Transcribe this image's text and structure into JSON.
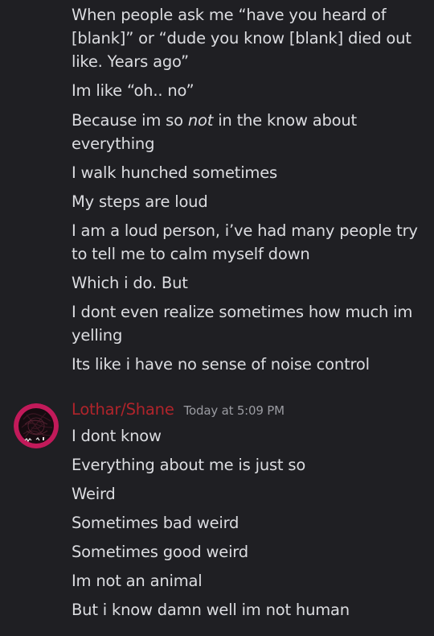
{
  "prev_messages": [
    "When people ask me “have you heard of [blank]” or “dude you know [blank] died out like. Years ago”",
    "Im like “oh.. no”",
    "Because im so ",
    "not",
    " in the know about everything",
    "I walk hunched sometimes",
    "My steps are loud",
    "I am a loud person, i’ve had many people try to tell me to calm myself down",
    "Which i do. But",
    "I dont even realize sometimes how much im yelling",
    "Its like i have no sense of noise control"
  ],
  "post": {
    "username": "Lothar/Shane",
    "timestamp": "Today at 5:09 PM",
    "avatar": "avatar-image",
    "messages": [
      "I dont know",
      "Everything about me is just so",
      "Weird",
      "Sometimes bad weird",
      "Sometimes good weird",
      "Im not an animal",
      "But i know damn well im not human"
    ]
  },
  "colors": {
    "background": "#1f1f23",
    "text": "#dcdde1",
    "username": "#b0242b",
    "timestamp": "#9a9ba1"
  }
}
